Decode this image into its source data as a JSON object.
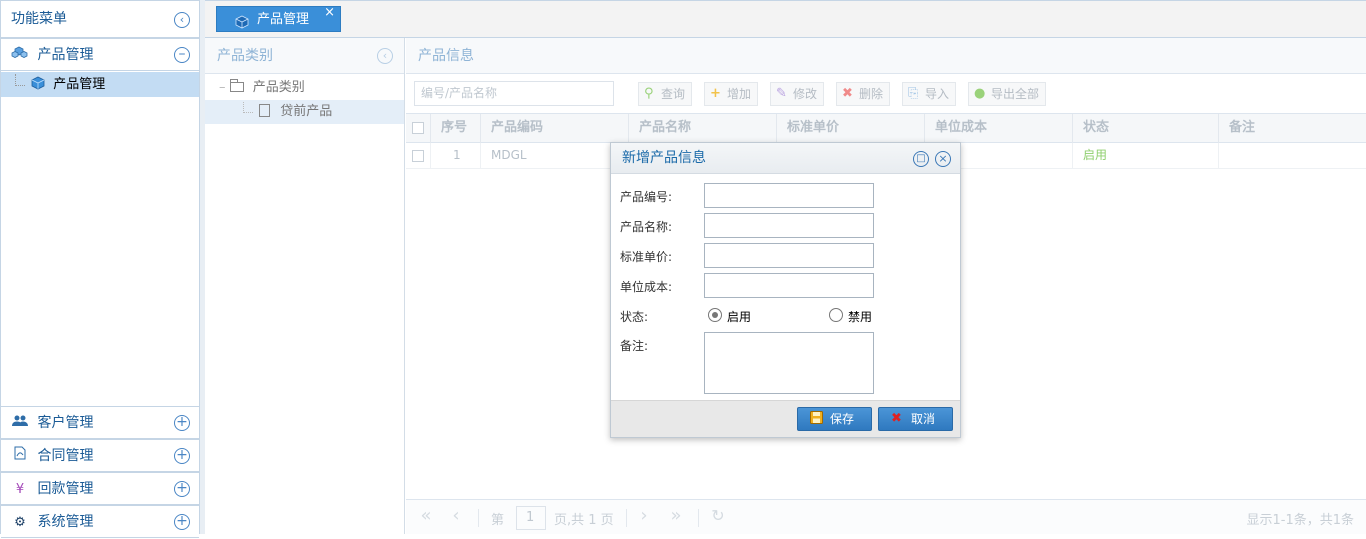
{
  "sidebar": {
    "title": "功能菜单",
    "collapse_icon": "chevron-left-circle-icon",
    "sections": [
      {
        "label": "产品管理",
        "icon": "cubes-icon",
        "toggle": "collapse",
        "items": [
          {
            "label": "产品管理",
            "selected": true
          }
        ]
      },
      {
        "label": "客户管理",
        "icon": "users-icon",
        "toggle": "expand"
      },
      {
        "label": "合同管理",
        "icon": "document-icon",
        "toggle": "expand"
      },
      {
        "label": "回款管理",
        "icon": "yen-icon",
        "toggle": "expand"
      },
      {
        "label": "系统管理",
        "icon": "gear-icon",
        "toggle": "expand"
      }
    ]
  },
  "tabs": [
    {
      "label": "产品管理",
      "active": true
    }
  ],
  "category_panel": {
    "title": "产品类别",
    "tree": [
      {
        "label": "产品类别",
        "type": "folder"
      },
      {
        "label": "贷前产品",
        "type": "file",
        "selected": true
      }
    ]
  },
  "info_panel": {
    "title": "产品信息",
    "search_placeholder": "编号/产品名称",
    "toolbar": {
      "query": "查询",
      "add": "增加",
      "edit": "修改",
      "delete": "删除",
      "import": "导入",
      "export_all": "导出全部"
    },
    "columns": [
      "序号",
      "产品编码",
      "产品名称",
      "标准单价",
      "单位成本",
      "状态",
      "备注"
    ],
    "rows": [
      {
        "index": "1",
        "code": "MDGL",
        "name": "",
        "price": "",
        "cost": "",
        "status": "启用",
        "remark": ""
      }
    ],
    "pager": {
      "page_prefix": "第",
      "page_value": "1",
      "page_suffix": "页,共 1 页",
      "summary": "显示1-1条，共1条"
    }
  },
  "dialog": {
    "title": "新增产品信息",
    "fields": {
      "code_label": "产品编号:",
      "name_label": "产品名称:",
      "price_label": "标准单价:",
      "cost_label": "单位成本:",
      "status_label": "状态:",
      "remark_label": "备注:"
    },
    "status_options": [
      {
        "label": "启用",
        "checked": true
      },
      {
        "label": "禁用",
        "checked": false
      }
    ],
    "save_label": "保存",
    "cancel_label": "取消"
  },
  "colors": {
    "accent": "#3a8fd9",
    "title_blue": "#1b5b96",
    "status_enabled": "#7bc35a",
    "cancel_icon": "#e02020",
    "save_icon": "#f0b020"
  }
}
